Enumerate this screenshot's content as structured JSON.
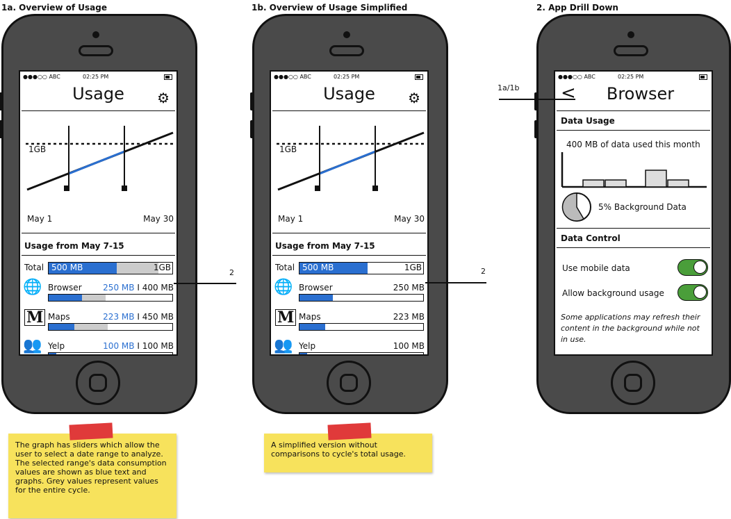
{
  "captions": {
    "a": "1a. Overview of Usage",
    "b": "1b. Overview of Usage Simplified",
    "c": "2. App Drill Down"
  },
  "status": {
    "signal": "●●●○○ ABC",
    "time": "02:25 PM"
  },
  "usage_screen": {
    "title": "Usage",
    "gear_icon": "gear-icon",
    "graph": {
      "limit_label": "1GB",
      "start_label": "May 1",
      "end_label": "May 30"
    },
    "range_title": "Usage from May 7-15",
    "total": {
      "label": "Total",
      "value": "500 MB",
      "cap": "1GB",
      "fraction": 0.5
    },
    "apps": [
      {
        "name": "Browser",
        "icon": "globe-icon",
        "used": "250 MB",
        "sep": "I",
        "total": "400 MB",
        "used_frac": 0.27,
        "total_frac": 0.46
      },
      {
        "name": "Maps",
        "icon": "maps-icon",
        "used": "223 MB",
        "sep": "I",
        "total": "450 MB",
        "used_frac": 0.21,
        "total_frac": 0.48
      },
      {
        "name": "Yelp",
        "icon": "people-icon",
        "used": "100 MB",
        "sep": "I",
        "total": "100 MB",
        "used_frac": 0.06,
        "total_frac": 0.06
      }
    ]
  },
  "simple_screen": {
    "title": "Usage",
    "range_title": "Usage from May 7-15",
    "total": {
      "label": "Total",
      "value": "500 MB",
      "cap": "1GB",
      "fraction": 0.5
    },
    "apps": [
      {
        "name": "Browser",
        "value": "250 MB",
        "frac": 0.27
      },
      {
        "name": "Maps",
        "value": "223 MB",
        "frac": 0.21
      },
      {
        "name": "Yelp",
        "value": "100 MB",
        "frac": 0.06
      }
    ]
  },
  "browser_screen": {
    "back": "<",
    "title": "Browser",
    "data_usage_header": "Data Usage",
    "data_used_text": "400 MB of data used this month",
    "background_text": "5% Background Data",
    "data_control_header": "Data Control",
    "toggles": [
      {
        "label": "Use mobile data",
        "on": true
      },
      {
        "label": "Allow background usage",
        "on": true
      }
    ],
    "note": "Some applications may refresh their content in the background while not in use."
  },
  "annotations": {
    "to_drill": "2",
    "back_link": "1a/1b"
  },
  "notes": {
    "a": "The graph has sliders which allow the user to select a date range to analyze. The selected range's data consumption values are shown as blue text and graphs. Grey values represent values for the entire cycle.",
    "b": "A simplified version without comparisons to cycle's total usage."
  },
  "colors": {
    "accent": "#2a6fd0",
    "grey": "#cccccc",
    "toggle": "#4a9e3a",
    "note": "#f7e25c",
    "tape": "#e03a3a"
  }
}
